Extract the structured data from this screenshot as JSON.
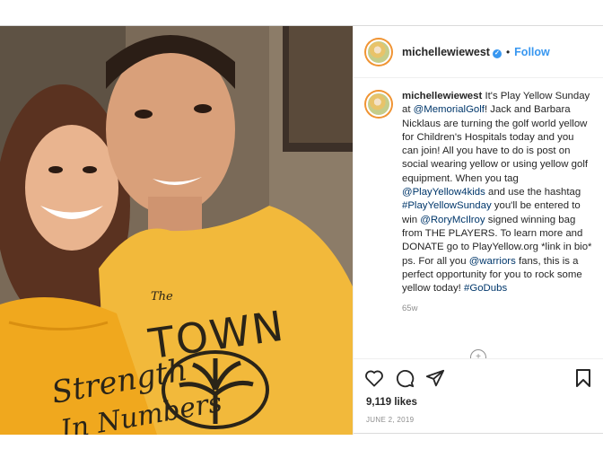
{
  "post": {
    "username": "michellewiewest",
    "follow_label": "Follow",
    "separator": "•",
    "verified_mark": "✓",
    "photo": {
      "shirt_left_text_1": "Strength",
      "shirt_left_text_2": "In Numbers",
      "shirt_right_small": "The",
      "shirt_right_big": "TOWN"
    },
    "caption": {
      "username": "michellewiewest",
      "parts": [
        " It's Play Yellow Sunday at ",
        "@MemorialGolf",
        "! Jack and Barbara Nicklaus are turning the golf world yellow for Children's Hospitals today and you can join! All you have to do is post on social wearing yellow or using yellow golf equipment. When you tag ",
        "@PlayYellow4kids",
        " and use the hashtag ",
        "#PlayYellowSunday",
        " you'll be entered to win ",
        "@RoryMcIlroy",
        " signed winning bag from THE PLAYERS. To learn more and DONATE go to PlayYellow.org *link in bio* ps. For all you ",
        "@warriors",
        " fans, this is a perfect opportunity for you to rock some yellow today! ",
        "#GoDubs"
      ],
      "time_ago": "65w"
    },
    "actions": {
      "like_icon": "heart-icon",
      "comment_icon": "comment-icon",
      "share_icon": "share-icon",
      "save_icon": "bookmark-icon"
    },
    "likes": "9,119 likes",
    "date": "JUNE 2, 2019",
    "colors": {
      "link": "#00376b",
      "follow": "#3897f0",
      "muted": "#8e8e8e",
      "shirt_yellow": "#f2b93b"
    }
  }
}
